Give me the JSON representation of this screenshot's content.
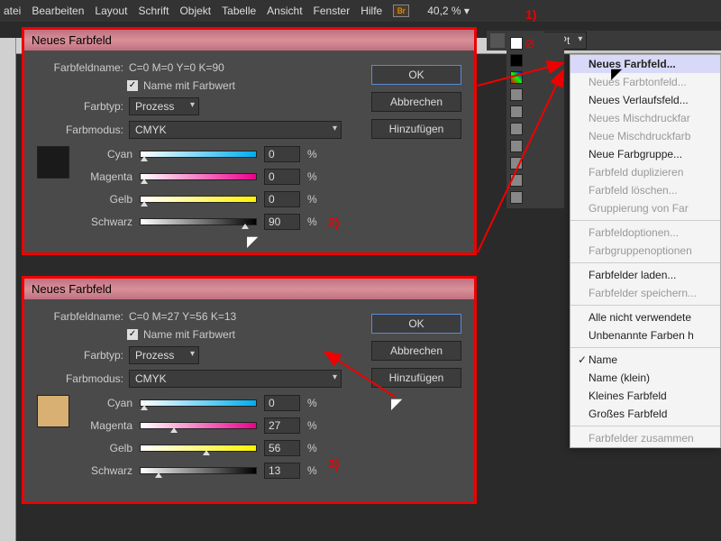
{
  "menubar": [
    "atei",
    "Bearbeiten",
    "Layout",
    "Schrift",
    "Objekt",
    "Tabelle",
    "Ansicht",
    "Fenster",
    "Hilfe"
  ],
  "zoom": "40,2 %",
  "strokeWeight": "0 Pt",
  "dialog1": {
    "title": "Neues Farbfeld",
    "nameLabel": "Farbfeldname:",
    "nameValue": "C=0 M=0 Y=0 K=90",
    "cbLabel": "Name mit Farbwert",
    "typeLabel": "Farbtyp:",
    "typeValue": "Prozess",
    "modeLabel": "Farbmodus:",
    "modeValue": "CMYK",
    "channels": [
      {
        "name": "Cyan",
        "value": "0",
        "grad": "linear-gradient(to right,#fff,#00aeef)"
      },
      {
        "name": "Magenta",
        "value": "0",
        "grad": "linear-gradient(to right,#fff,#ec008c)"
      },
      {
        "name": "Gelb",
        "value": "0",
        "grad": "linear-gradient(to right,#fff,#fff200)"
      },
      {
        "name": "Schwarz",
        "value": "90",
        "grad": "linear-gradient(to right,#fff,#000)"
      }
    ],
    "swatchColor": "#1a1a1a",
    "ok": "OK",
    "cancel": "Abbrechen",
    "add": "Hinzufügen"
  },
  "dialog2": {
    "title": "Neues Farbfeld",
    "nameLabel": "Farbfeldname:",
    "nameValue": "C=0 M=27 Y=56 K=13",
    "cbLabel": "Name mit Farbwert",
    "typeLabel": "Farbtyp:",
    "typeValue": "Prozess",
    "modeLabel": "Farbmodus:",
    "modeValue": "CMYK",
    "channels": [
      {
        "name": "Cyan",
        "value": "0",
        "grad": "linear-gradient(to right,#fff,#00aeef)"
      },
      {
        "name": "Magenta",
        "value": "27",
        "grad": "linear-gradient(to right,#fff,#ec008c)"
      },
      {
        "name": "Gelb",
        "value": "56",
        "grad": "linear-gradient(to right,#fff,#fff200)"
      },
      {
        "name": "Schwarz",
        "value": "13",
        "grad": "linear-gradient(to right,#fff,#000)"
      }
    ],
    "swatchColor": "#d8b074",
    "ok": "OK",
    "cancel": "Abbrechen",
    "add": "Hinzufügen"
  },
  "flyout": [
    {
      "label": "Neues Farbfeld...",
      "hl": true
    },
    {
      "label": "Neues Farbtonfeld...",
      "dis": true
    },
    {
      "label": "Neues Verlaufsfeld..."
    },
    {
      "label": "Neues Mischdruckfar",
      "dis": true
    },
    {
      "label": "Neue Mischdruckfarb",
      "dis": true
    },
    {
      "label": "Neue Farbgruppe..."
    },
    {
      "label": "Farbfeld duplizieren",
      "dis": true
    },
    {
      "label": "Farbfeld löschen...",
      "dis": true
    },
    {
      "label": "Gruppierung von Far",
      "dis": true
    },
    {
      "sep": true
    },
    {
      "label": "Farbfeldoptionen...",
      "dis": true
    },
    {
      "label": "Farbgruppenoptionen",
      "dis": true
    },
    {
      "sep": true
    },
    {
      "label": "Farbfelder laden..."
    },
    {
      "label": "Farbfelder speichern...",
      "dis": true
    },
    {
      "sep": true
    },
    {
      "label": "Alle nicht verwendete"
    },
    {
      "label": "Unbenannte Farben h"
    },
    {
      "sep": true
    },
    {
      "label": "Name",
      "chk": true
    },
    {
      "label": "Name (klein)"
    },
    {
      "label": "Kleines Farbfeld"
    },
    {
      "label": "Großes Farbfeld"
    },
    {
      "sep": true
    },
    {
      "label": "Farbfelder zusammen",
      "dis": true
    }
  ],
  "annotations": {
    "a1": "1)",
    "a2": "2)",
    "a3": "3)"
  }
}
